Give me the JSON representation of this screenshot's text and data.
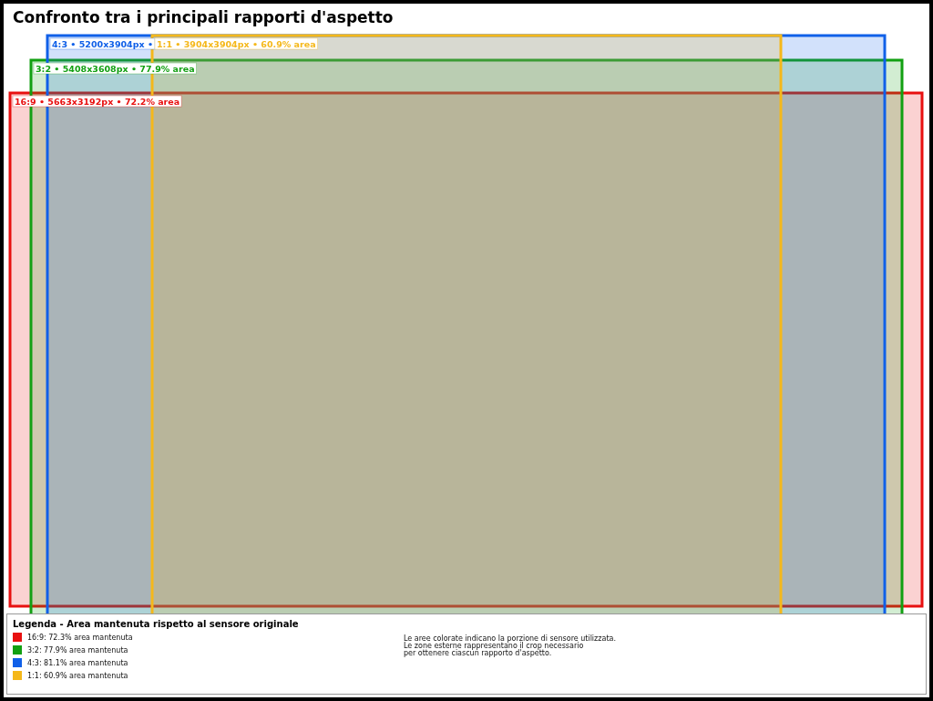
{
  "title": "Confronto tra i principali rapporti d'aspetto",
  "crops": [
    {
      "kind": "open",
      "label": "4:3 • 5200x3904px •",
      "color": "#1060e8"
    },
    {
      "kind": "open",
      "label": "1:1 • 3904x3904px • 60.9% area",
      "color": "#f5b81a"
    },
    {
      "kind": "open",
      "label": "3:2 • 5408x3608px • 77.9% area",
      "color": "#12a012"
    },
    {
      "kind": "open",
      "label": "16:9 • 5663x3192px • 72.2% area",
      "color": "#e81010"
    }
  ],
  "legend": {
    "title": "Legenda - Area mantenuta rispetto al sensore originale",
    "items": [
      {
        "label": "16:9: 72.3% area mantenuta",
        "color": "#e81010"
      },
      {
        "label": "3:2: 77.9% area mantenuta",
        "color": "#12a012"
      },
      {
        "label": "4:3: 81.1% area mantenuta",
        "color": "#1060e8"
      },
      {
        "label": "1:1: 60.9% area mantenuta",
        "color": "#f5b81a"
      }
    ],
    "note": [
      "Le aree colorate indicano la porzione di sensore utilizzata.",
      "Le zone esterne rappresentano il crop necessario",
      "per ottenere ciascun rapporto d'aspetto."
    ]
  }
}
